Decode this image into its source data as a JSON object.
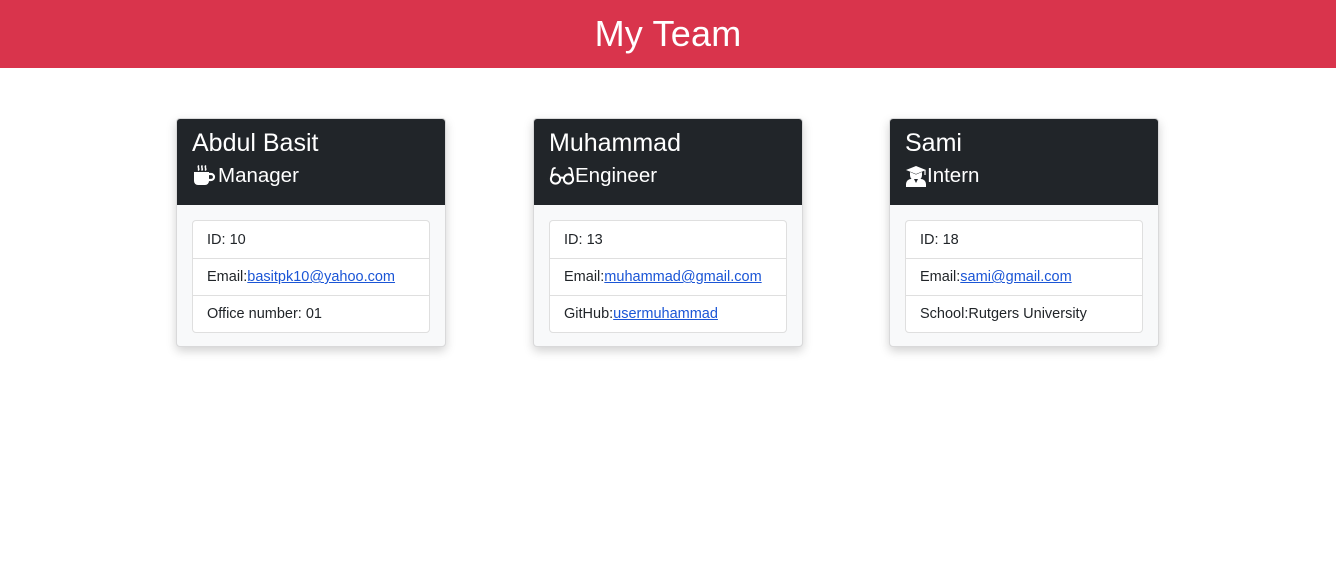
{
  "header": {
    "title": "My Team"
  },
  "colors": {
    "header_bg": "#d9344c",
    "card_head_bg": "#212529",
    "link": "#1a55d6"
  },
  "team": [
    {
      "name": "Abdul Basit",
      "role": "Manager",
      "role_icon": "mug-hot-icon",
      "id_label": "ID: ",
      "id": "10",
      "email_label": "Email:",
      "email": "basitpk10@yahoo.com",
      "extra_label": "Office number: ",
      "extra_value": "01"
    },
    {
      "name": "Muhammad",
      "role": "Engineer",
      "role_icon": "glasses-icon",
      "id_label": "ID: ",
      "id": "13",
      "email_label": "Email:",
      "email": "muhammad@gmail.com",
      "extra_label": "GitHub:",
      "extra_value": "usermuhammad"
    },
    {
      "name": "Sami",
      "role": "Intern",
      "role_icon": "user-graduate-icon",
      "id_label": "ID: ",
      "id": "18",
      "email_label": "Email:",
      "email": "sami@gmail.com",
      "extra_label": "School:",
      "extra_value": "Rutgers University"
    }
  ]
}
